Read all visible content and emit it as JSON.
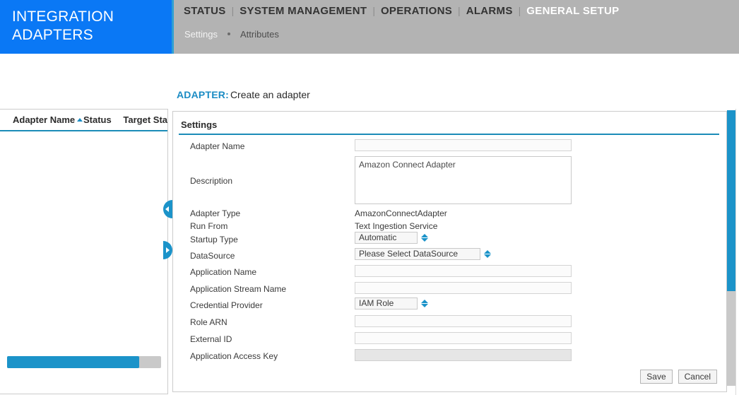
{
  "brand": {
    "line1": "INTEGRATION",
    "line2": "ADAPTERS",
    "color": "#0a78f5"
  },
  "topnav": {
    "separator": "|",
    "items": [
      {
        "label": "STATUS",
        "active": false
      },
      {
        "label": "SYSTEM MANAGEMENT",
        "active": false
      },
      {
        "label": "OPERATIONS",
        "active": false
      },
      {
        "label": "ALARMS",
        "active": false
      },
      {
        "label": "GENERAL SETUP",
        "active": true
      }
    ]
  },
  "subnav": {
    "items": [
      {
        "label": "Settings",
        "active": true
      },
      {
        "label": "Attributes",
        "active": false
      }
    ]
  },
  "breadcrumb": {
    "key": "ADAPTER:",
    "value": "Create an adapter",
    "key_color": "#1b8cc4"
  },
  "adapter_list": {
    "columns": [
      {
        "label": "Adapter Name",
        "sorted": true,
        "sort_direction": "asc"
      },
      {
        "label": "Status",
        "sorted": false
      },
      {
        "label": "Target Sta",
        "sorted": false
      }
    ],
    "rows": [],
    "hscroll_percent": 86
  },
  "handles": {
    "collapse_left_icon": "triangle-left",
    "expand_right_icon": "triangle-right"
  },
  "settings_panel": {
    "title": "Settings",
    "accent_color": "#1b8cb8",
    "fields": [
      {
        "label": "Adapter Name",
        "type": "text",
        "value": "",
        "placeholder": "",
        "disabled": false
      },
      {
        "label": "Description",
        "type": "textarea",
        "value": "Amazon Connect Adapter",
        "placeholder": "",
        "disabled": false
      },
      {
        "label": "Adapter Type",
        "type": "static",
        "value": "AmazonConnectAdapter"
      },
      {
        "label": "Run From",
        "type": "static",
        "value": "Text Ingestion Service"
      },
      {
        "label": "Startup Type",
        "type": "select",
        "value": "Automatic"
      },
      {
        "label": "DataSource",
        "type": "select",
        "value": "Please Select DataSource"
      },
      {
        "label": "Application Name",
        "type": "text",
        "value": "",
        "placeholder": "",
        "disabled": false
      },
      {
        "label": "Application Stream Name",
        "type": "text",
        "value": "",
        "placeholder": "",
        "disabled": false
      },
      {
        "label": "Credential Provider",
        "type": "select",
        "value": "IAM Role"
      },
      {
        "label": "Role ARN",
        "type": "text",
        "value": "",
        "placeholder": "",
        "disabled": false
      },
      {
        "label": "External ID",
        "type": "text",
        "value": "",
        "placeholder": "",
        "disabled": false
      },
      {
        "label": "Application Access Key",
        "type": "text",
        "value": "",
        "placeholder": "",
        "disabled": true
      }
    ],
    "buttons": {
      "save_label": "Save",
      "cancel_label": "Cancel"
    }
  },
  "scrollbar": {
    "vertical_thumb_percent": 66,
    "thumb_color": "#1b93c9",
    "track_color": "#c9c9c9"
  }
}
